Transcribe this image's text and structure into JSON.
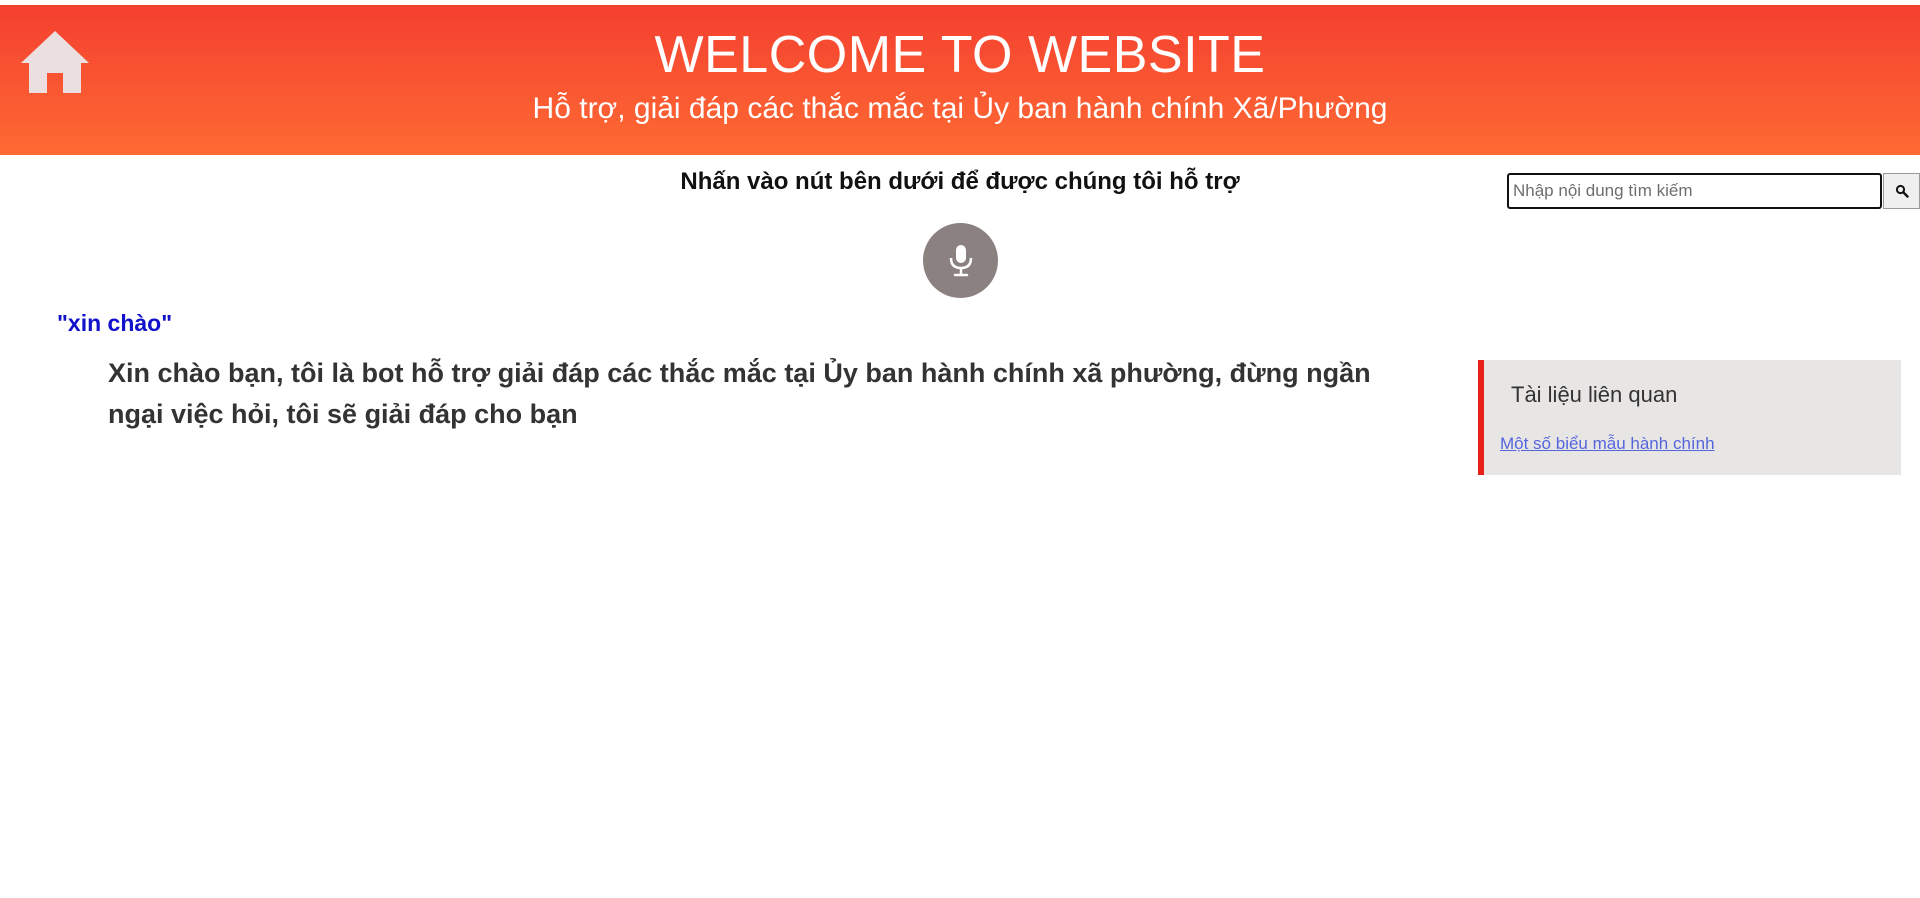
{
  "header": {
    "title": "WELCOME TO WEBSITE",
    "subtitle": "Hỗ trợ, giải đáp các thắc mắc tại Ủy ban hành chính Xã/Phường",
    "home_icon": "home-icon"
  },
  "main": {
    "instruction": "Nhấn vào nút bên dưới để được chúng tôi hỗ trợ",
    "mic_icon": "microphone-icon",
    "user_query": "\"xin chào\"",
    "bot_reply": "Xin chào bạn, tôi là bot hỗ trợ giải đáp các thắc mắc tại Ủy ban hành chính xã phường, đừng ngần ngại việc hỏi, tôi sẽ giải đáp cho bạn"
  },
  "search": {
    "placeholder": "Nhập nội dung tìm kiếm",
    "value": "",
    "button_icon": "search-icon"
  },
  "related": {
    "title": "Tài liệu liên quan",
    "links": [
      {
        "label": "Một số biểu mẫu hành chính"
      }
    ]
  },
  "colors": {
    "header_gradient_top": "#f43f30",
    "header_gradient_bottom": "#fe6a33",
    "mic_button": "#8b8181",
    "user_query": "#1111cc",
    "panel_accent": "#e8201a",
    "panel_background": "#e8e6e5",
    "link": "#5566dd"
  }
}
